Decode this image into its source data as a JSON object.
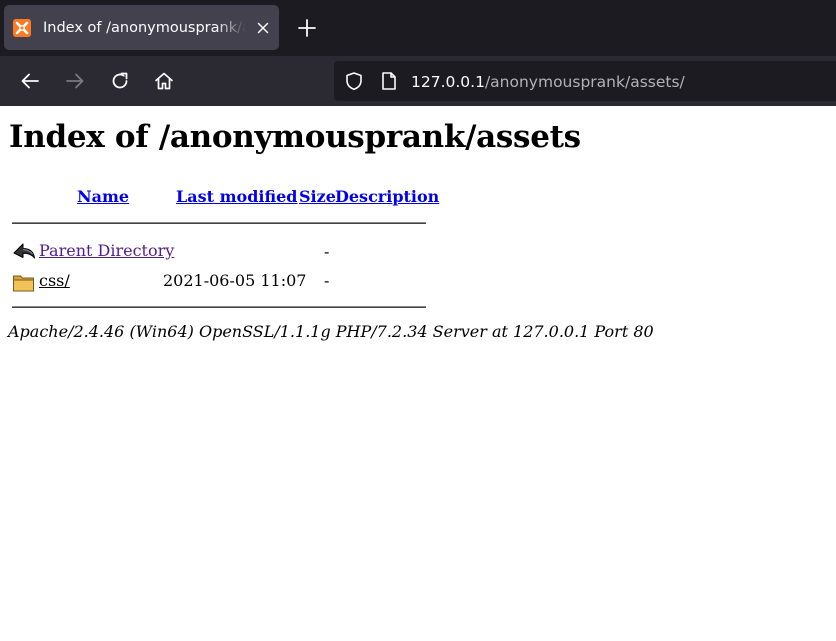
{
  "browser": {
    "tab_title": "Index of /anonymousprank/assets",
    "favicon": "xampp-icon",
    "url_host": "127.0.0.1",
    "url_path": "/anonymousprank/assets/",
    "colors": {
      "tabstrip": "#1c1b22",
      "tab_active": "#42414d",
      "toolbar": "#2b2a33",
      "urlbar": "#1c1b22"
    }
  },
  "page": {
    "title": "Index of /anonymousprank/assets",
    "columns": {
      "name": "Name",
      "last_modified": "Last modified",
      "size": "Size",
      "description": "Description"
    },
    "rows": [
      {
        "icon": "back-arrow-icon",
        "name": "Parent Directory",
        "last_modified": "",
        "size": "-",
        "description": ""
      },
      {
        "icon": "folder-icon",
        "name": "css/",
        "last_modified": "2021-06-05 11:07",
        "size": "-",
        "description": ""
      }
    ],
    "address": "Apache/2.4.46 (Win64) OpenSSL/1.1.1g PHP/7.2.34 Server at 127.0.0.1 Port 80",
    "colors": {
      "link": "#0000ee",
      "visited": "#551a8b"
    }
  }
}
